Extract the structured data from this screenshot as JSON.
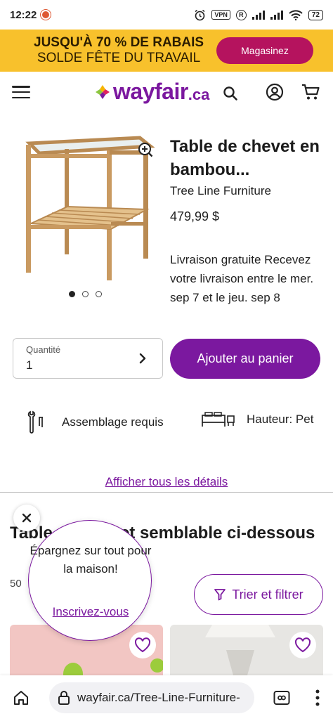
{
  "status_bar": {
    "time": "12:22",
    "vpn": "VPN",
    "r_badge": "R",
    "battery": "72"
  },
  "promo": {
    "line1": "JUSQU'À 70 % DE RABAIS",
    "line2": "SOLDE FÊTE DU TRAVAIL",
    "button": "Magasinez",
    "bg_color": "#f8c12c",
    "button_color": "#b5135e"
  },
  "header": {
    "logo_text": "wayfair",
    "logo_suffix": ".ca",
    "brand_color": "#7b189f"
  },
  "product": {
    "title": "Table de chevet en bambou...",
    "brand": "Tree Line Furniture",
    "price": "479,99 $",
    "shipping": "Livraison gratuite Recevez votre livraison entre le mer. sep 7 et le jeu. sep 8",
    "image_count": 3,
    "active_image": 1
  },
  "quantity": {
    "label": "Quantité",
    "value": "1"
  },
  "add_to_cart": {
    "label": "Ajouter au panier"
  },
  "features": {
    "assembly": "Assemblage requis",
    "height": "Hauteur: Pet"
  },
  "details_link": "Afficher tous les détails",
  "similar": {
    "title": "Table de chevet semblable ci-dessous",
    "count": "50",
    "filter_label": "Trier et filtrer"
  },
  "popup": {
    "message": "Épargnez sur tout pour la maison!",
    "cta": "Inscrivez-vous"
  },
  "browser": {
    "url": "wayfair.ca/Tree-Line-Furniture-"
  }
}
